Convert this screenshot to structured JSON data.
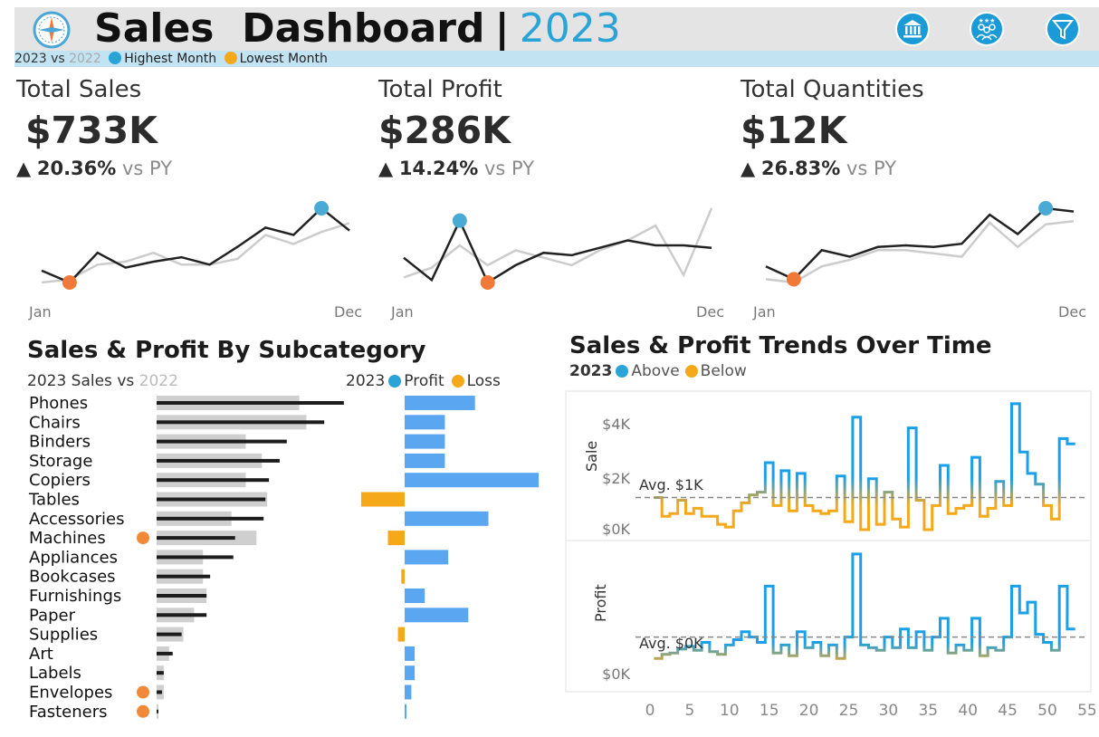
{
  "header": {
    "title": "Sales  Dashboard",
    "separator": "|",
    "year": "2023",
    "compare_year": "2023 vs ",
    "prior_year": "2022",
    "legend_high": "Highest Month",
    "legend_low": "Lowest Month",
    "icons": [
      "bank-icon",
      "people-icon",
      "filter-icon"
    ]
  },
  "colors": {
    "accent_blue": "#2aa3d6",
    "high_dot": "#4aaad6",
    "low_dot": "#f07838",
    "above": "#1aa0e8",
    "below": "#f5a81a",
    "profit_bar": "#5aa6f0",
    "loss_bar": "#f5a81a",
    "current_line": "#222222",
    "prior_line": "#cccccc"
  },
  "kpis": [
    {
      "title": "Total Sales",
      "value": "$733K",
      "arrow": "▲",
      "change": "20.36%",
      "vs": "vs PY",
      "axis_start": "Jan",
      "axis_end": "Dec",
      "current": [
        16,
        8,
        28,
        18,
        22,
        25,
        20,
        32,
        45,
        40,
        58,
        43
      ],
      "prior": [
        8,
        10,
        20,
        22,
        28,
        20,
        20,
        24,
        40,
        34,
        42,
        48
      ],
      "high_index": 10,
      "low_index": 1
    },
    {
      "title": "Total Profit",
      "value": "$286K",
      "arrow": "▲",
      "change": "14.24%",
      "vs": "vs PY",
      "axis_start": "Jan",
      "axis_end": "Dec",
      "current": [
        26,
        8,
        56,
        6,
        20,
        30,
        28,
        34,
        40,
        36,
        36,
        34
      ],
      "prior": [
        10,
        18,
        36,
        20,
        32,
        26,
        20,
        32,
        40,
        52,
        12,
        66
      ],
      "high_index": 2,
      "low_index": 3
    },
    {
      "title": "Total Quantities",
      "value": "$12K",
      "arrow": "▲",
      "change": "26.83%",
      "vs": "vs PY",
      "axis_start": "Jan",
      "axis_end": "Dec",
      "current": [
        18,
        10,
        28,
        24,
        30,
        31,
        30,
        32,
        50,
        38,
        54,
        52
      ],
      "prior": [
        10,
        8,
        18,
        22,
        28,
        28,
        26,
        24,
        45,
        30,
        44,
        46
      ],
      "high_index": 10,
      "low_index": 1
    }
  ],
  "subcategory": {
    "title": "Sales & Profit By Subcategory",
    "legend_label": "2023 Sales vs ",
    "legend_prior": "2022",
    "profit_legend_year": "2023",
    "profit_label": "Profit",
    "loss_label": "Loss"
  },
  "trend": {
    "title": "Sales & Profit Trends Over Time",
    "legend_year": "2023",
    "above_label": "Above",
    "below_label": "Below",
    "sale_axis_label": "Sale",
    "profit_axis_label": "Profit",
    "sale_ticks": [
      "$4K",
      "$2K",
      "$0K"
    ],
    "profit_ticks": [
      "$0K"
    ],
    "sale_avg_label": "Avg. $1K",
    "profit_avg_label": "Avg. $0K",
    "x_ticks": [
      "0",
      "5",
      "10",
      "15",
      "20",
      "25",
      "30",
      "35",
      "40",
      "45",
      "50",
      "55"
    ]
  },
  "chart_data": [
    {
      "type": "bar",
      "title": "Sales & Profit By Subcategory",
      "categories": [
        "Phones",
        "Chairs",
        "Binders",
        "Storage",
        "Copiers",
        "Tables",
        "Accessories",
        "Machines",
        "Appliances",
        "Bookcases",
        "Furnishings",
        "Paper",
        "Supplies",
        "Art",
        "Labels",
        "Envelopes",
        "Fasteners"
      ],
      "series": [
        {
          "name": "2023",
          "values": [
            105,
            94,
            73,
            69,
            63,
            61,
            60,
            44,
            43,
            30,
            28,
            28,
            14,
            9,
            4,
            3,
            1
          ]
        },
        {
          "name": "2022",
          "values": [
            80,
            84,
            50,
            59,
            50,
            62,
            42,
            56,
            26,
            26,
            28,
            21,
            15,
            7,
            4,
            4,
            1
          ]
        }
      ],
      "low_markers": [
        "Machines",
        "Envelopes",
        "Fasteners"
      ]
    },
    {
      "type": "bar",
      "title": "Profit",
      "categories": [
        "Phones",
        "Chairs",
        "Binders",
        "Storage",
        "Copiers",
        "Tables",
        "Accessories",
        "Machines",
        "Appliances",
        "Bookcases",
        "Furnishings",
        "Paper",
        "Supplies",
        "Art",
        "Labels",
        "Envelopes",
        "Fasteners"
      ],
      "values": [
        21,
        12,
        12,
        12,
        40,
        -13,
        25,
        -5,
        13,
        -1,
        6,
        19,
        -2,
        3,
        3,
        2,
        0.5
      ]
    },
    {
      "type": "line",
      "title": "Sales & Profit Trends Over Time",
      "ylabel": "Sale",
      "x": [
        1,
        2,
        3,
        4,
        5,
        6,
        7,
        8,
        9,
        10,
        11,
        12,
        13,
        14,
        15,
        16,
        17,
        18,
        19,
        20,
        21,
        22,
        23,
        24,
        25,
        26,
        27,
        28,
        29,
        30,
        31,
        32,
        33,
        34,
        35,
        36,
        37,
        38,
        39,
        40,
        41,
        42,
        43,
        44,
        45,
        46,
        47,
        48,
        49,
        50,
        51,
        52,
        53
      ],
      "y": [
        1.3,
        0.6,
        0.7,
        1.2,
        0.7,
        0.9,
        0.6,
        0.6,
        0.3,
        0.2,
        0.8,
        1.1,
        1.4,
        1.5,
        2.6,
        1.0,
        2.3,
        0.8,
        2.2,
        1.0,
        0.8,
        0.7,
        0.8,
        2.1,
        0.4,
        4.3,
        0.1,
        2.0,
        0.3,
        1.5,
        0.5,
        0.2,
        3.9,
        1.2,
        0.1,
        1.0,
        2.5,
        0.7,
        0.9,
        1.0,
        2.8,
        0.6,
        0.9,
        1.9,
        1.0,
        4.8,
        3.0,
        2.2,
        1.8,
        1.0,
        0.5,
        3.5,
        3.3
      ],
      "ylim": [
        0,
        5
      ],
      "avg": 1.3,
      "avg_label": "Avg. $1K"
    },
    {
      "type": "line",
      "title": "Profit",
      "ylabel": "Profit",
      "x": [
        1,
        2,
        3,
        4,
        5,
        6,
        7,
        8,
        9,
        10,
        11,
        12,
        13,
        14,
        15,
        16,
        17,
        18,
        19,
        20,
        21,
        22,
        23,
        24,
        25,
        26,
        27,
        28,
        29,
        30,
        31,
        32,
        33,
        34,
        35,
        36,
        37,
        38,
        39,
        40,
        41,
        42,
        43,
        44,
        45,
        46,
        47,
        48,
        49,
        50,
        51,
        52,
        53
      ],
      "y": [
        0.1,
        0.25,
        0.3,
        0.45,
        0.55,
        0.4,
        0.7,
        0.35,
        0.25,
        0.6,
        0.8,
        1.1,
        0.9,
        0.7,
        2.8,
        0.3,
        0.6,
        0.2,
        1.1,
        0.5,
        0.7,
        0.2,
        0.6,
        0.1,
        0.9,
        4.0,
        0.6,
        0.5,
        0.4,
        0.9,
        0.5,
        1.2,
        0.5,
        1.1,
        0.4,
        0.9,
        1.6,
        0.3,
        0.6,
        0.4,
        1.6,
        0.2,
        0.5,
        0.4,
        0.9,
        2.8,
        1.8,
        2.2,
        1.0,
        0.7,
        0.4,
        2.8,
        1.2
      ],
      "ylim": [
        -0.4,
        4.2
      ],
      "avg": 0.9,
      "avg_label": "Avg. $0K"
    }
  ]
}
